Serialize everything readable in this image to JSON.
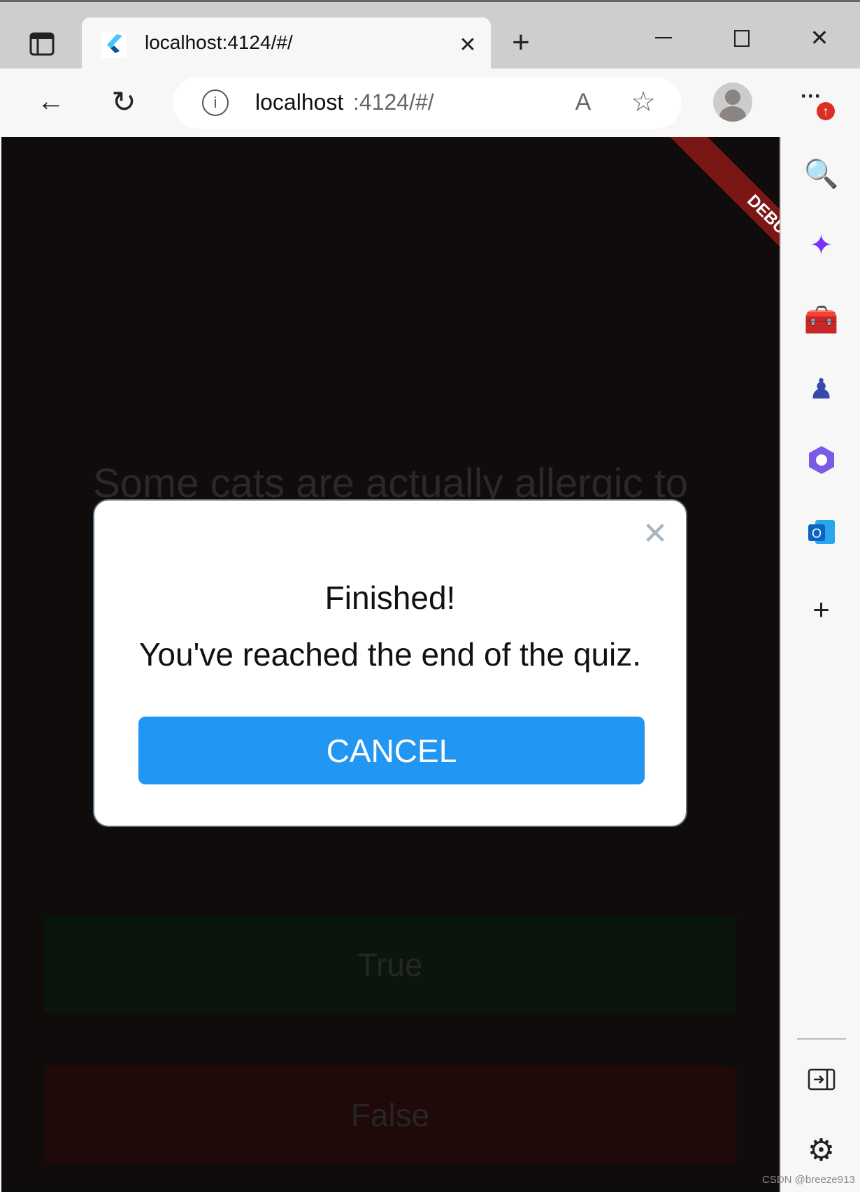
{
  "browser": {
    "tab_title": "localhost:4124/#/",
    "url_host": "localhost",
    "url_rest": ":4124/#/",
    "icons": [
      "tab-actions-icon",
      "flutter-favicon",
      "close-tab-icon",
      "new-tab-icon",
      "minimize-icon",
      "maximize-icon",
      "close-window-icon",
      "back-icon",
      "refresh-icon",
      "info-icon",
      "read-aloud-icon",
      "add-favorite-icon",
      "profile-avatar",
      "more-menu-icon",
      "update-badge-icon"
    ]
  },
  "sidebar": {
    "icons": [
      "search-icon",
      "copilot-icon",
      "tools-icon",
      "games-icon",
      "office-icon",
      "outlook-icon",
      "add-icon",
      "hide-sidebar-icon",
      "settings-icon"
    ]
  },
  "app": {
    "debug_banner": "DEBUG",
    "question": "Some cats are actually allergic to",
    "true_label": "True",
    "false_label": "False",
    "colors": {
      "true_button": "#0a160c",
      "false_button": "#200909",
      "background": "#100c0c"
    }
  },
  "dialog": {
    "title": "Finished!",
    "message": "You've reached the end of the quiz.",
    "cancel_label": "CANCEL",
    "accent": "#2196f3"
  },
  "watermark": "CSDN @breeze913"
}
